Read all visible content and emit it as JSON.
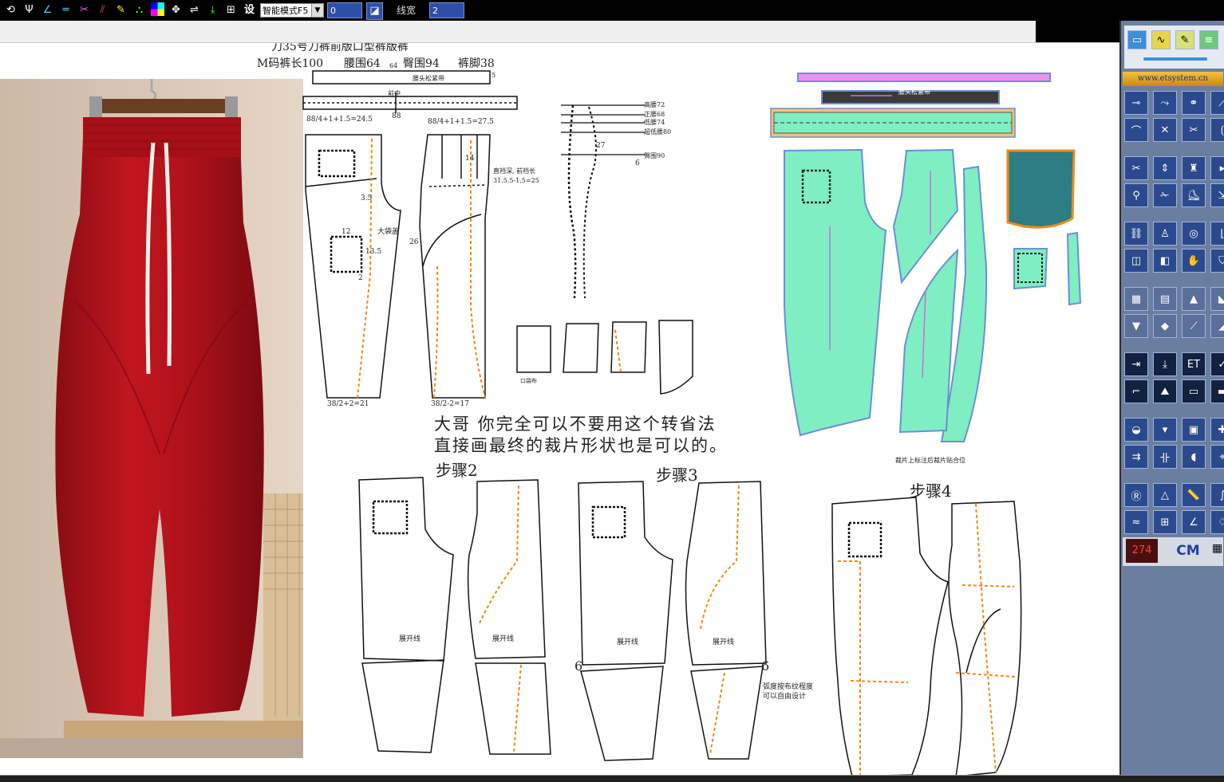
{
  "toolbar": {
    "settings_label": "设",
    "mode_select_value": "智能模式F5",
    "field_1_value": "0",
    "linewidth_label": "线宽",
    "linewidth_value": "2"
  },
  "draft": {
    "header_line1": "刀35号刀裤前版口型裤版裤",
    "header_size_label": "M码裤长100",
    "header_waist": "腰围64",
    "header_hip": "臀围94",
    "header_hem": "裤脚38",
    "small_64": "64",
    "small_5": "5",
    "waistband_label": "腰头松紧带",
    "front_center_label": "前中",
    "label_88": "88",
    "front_formula": "88/4+1+1.5=24.5",
    "back_formula": "88/4+1+1.5=27.5",
    "front_hem_formula": "38/2+2=21",
    "back_hem_formula": "38/2-2=17",
    "pocket_label": "大袋盖",
    "num_12": "12",
    "num_13_5": "13.5",
    "num_2": "2",
    "num_3_5": "3.5",
    "num_26": "26",
    "num_14": "14",
    "crotch_note": "直裆深, 前裆长",
    "crotch_formula": "31.5.5-1.5=25",
    "side_high_waist": "高腰72",
    "side_mid_waist": "正腰68",
    "side_low_waist": "低腰74",
    "side_hip_line": "超低腰80",
    "side_hip": "臀围90",
    "num_27": "27",
    "num_6": "6",
    "small_piece_label": "口袋布",
    "pattern_band_label": "腰头松紧带",
    "curve_note": "裁片上标注后裁片贴合位",
    "note_line1": "大哥  你完全可以不要用这个转省法",
    "note_line2": "直接画最终的裁片形状也是可以的。",
    "step2": "步骤2",
    "step3": "步骤3",
    "step4": "步骤4",
    "expand_line": "展开线",
    "num_6b": "6",
    "arc_note_1": "弧度按布纹程度",
    "arc_note_2": "可以自由设计"
  },
  "right_panel": {
    "website": "www.etsystem.cn",
    "counter": "274",
    "unit": "CM"
  },
  "colors": {
    "pattern_fill": "#7fefc3",
    "pattern_outline": "#6a8fd8",
    "waistband_top": "#f28fe9",
    "dashed_orange": "#f28a18",
    "pants_red": "#b8141e",
    "toolbar_bg": "#000000",
    "panel_button": "#2b4a8e"
  }
}
